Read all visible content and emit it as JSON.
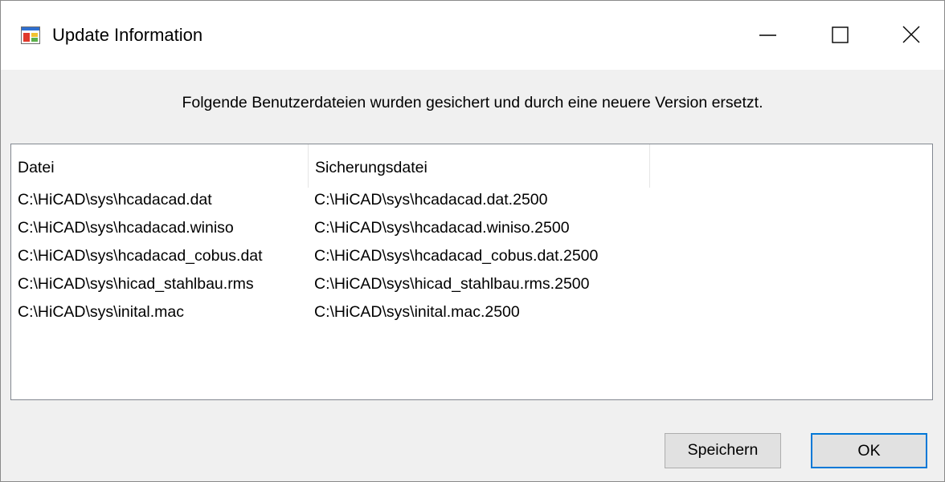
{
  "window": {
    "title": "Update Information",
    "icon": "app-window-icon"
  },
  "caption_buttons": {
    "minimize_icon": "minimize-icon",
    "maximize_icon": "maximize-icon",
    "close_icon": "close-icon"
  },
  "message": "Folgende Benutzerdateien wurden gesichert und durch eine neuere Version ersetzt.",
  "list": {
    "columns": [
      "Datei",
      "Sicherungsdatei"
    ],
    "rows": [
      [
        "C:\\HiCAD\\sys\\hcadacad.dat",
        "C:\\HiCAD\\sys\\hcadacad.dat.2500"
      ],
      [
        "C:\\HiCAD\\sys\\hcadacad.winiso",
        "C:\\HiCAD\\sys\\hcadacad.winiso.2500"
      ],
      [
        "C:\\HiCAD\\sys\\hcadacad_cobus.dat",
        "C:\\HiCAD\\sys\\hcadacad_cobus.dat.2500"
      ],
      [
        "C:\\HiCAD\\sys\\hicad_stahlbau.rms",
        "C:\\HiCAD\\sys\\hicad_stahlbau.rms.2500"
      ],
      [
        "C:\\HiCAD\\sys\\inital.mac",
        "C:\\HiCAD\\sys\\inital.mac.2500"
      ]
    ]
  },
  "buttons": {
    "save_label": "Speichern",
    "ok_label": "OK"
  },
  "colors": {
    "accent": "#0078d7",
    "dialog_background": "#f0f0f0",
    "titlebar_background": "#ffffff"
  }
}
